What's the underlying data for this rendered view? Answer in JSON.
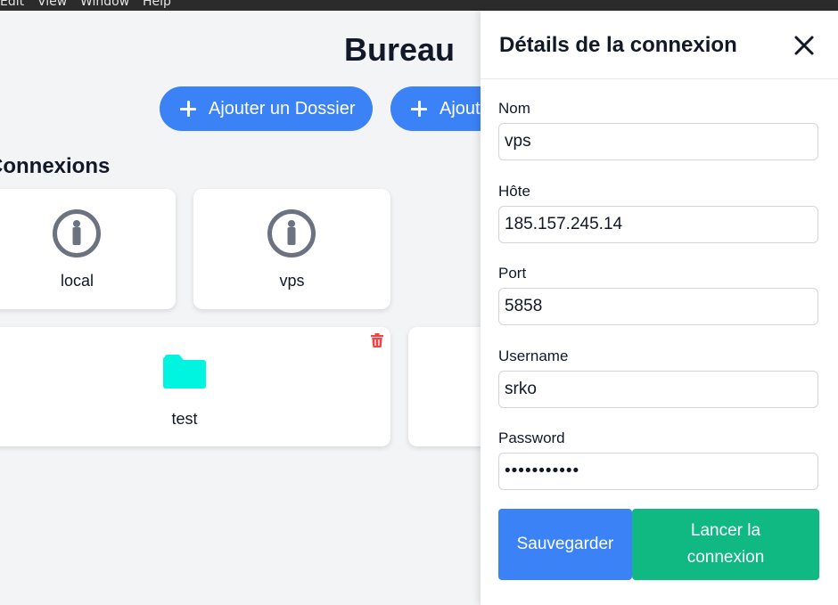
{
  "menubar": {
    "items": [
      "Edit",
      "View",
      "Window",
      "Help"
    ]
  },
  "main": {
    "title": "Bureau",
    "add_folder_label": "Ajouter un Dossier",
    "add_connection_label_partial": "Ajout",
    "connections_title": "Connexions",
    "connections": [
      {
        "label": "local",
        "icon": "info-icon"
      },
      {
        "label": "vps",
        "icon": "info-icon"
      }
    ],
    "folders": [
      {
        "label": "test",
        "icon": "folder-icon"
      }
    ]
  },
  "panel": {
    "title": "Détails de la connexion",
    "fields": {
      "name": {
        "label": "Nom",
        "value": "vps"
      },
      "host": {
        "label": "Hôte",
        "value": "185.157.245.14"
      },
      "port": {
        "label": "Port",
        "value": "5858"
      },
      "username": {
        "label": "Username",
        "value": "srko"
      },
      "password": {
        "label": "Password",
        "value": "•••••••••••"
      }
    },
    "save_label": "Sauvegarder",
    "launch_label": "Lancer la connexion"
  },
  "colors": {
    "primary": "#3b82f6",
    "success": "#10b981",
    "danger": "#ef4444",
    "folder": "#00f5e0",
    "icon_gray": "#6b7280",
    "background": "#f3f4f6"
  }
}
